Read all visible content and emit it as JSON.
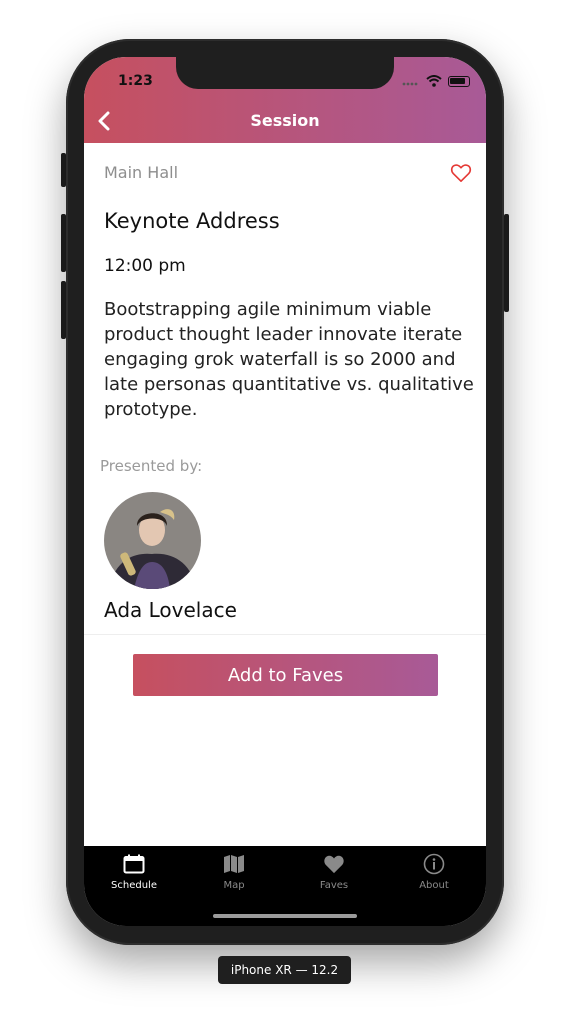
{
  "status_bar": {
    "time": "1:23"
  },
  "header": {
    "title": "Session"
  },
  "session": {
    "room": "Main Hall",
    "title": "Keynote Address",
    "time": "12:00 pm",
    "description": "Bootstrapping agile minimum viable product thought leader innovate iterate engaging grok waterfall is so 2000 and late personas quantitative vs. qualitative prototype.",
    "presented_by_label": "Presented by:",
    "speaker_name": "Ada Lovelace"
  },
  "actions": {
    "add_to_faves": "Add to Faves"
  },
  "tabs": [
    {
      "label": "Schedule",
      "icon": "calendar-icon",
      "active": true
    },
    {
      "label": "Map",
      "icon": "map-icon",
      "active": false
    },
    {
      "label": "Faves",
      "icon": "heart-icon",
      "active": false
    },
    {
      "label": "About",
      "icon": "info-icon",
      "active": false
    }
  ],
  "device_label": "iPhone XR — 12.2",
  "colors": {
    "gradient_start": "#c6505f",
    "gradient_end": "#a85a97",
    "favorite_icon": "#e53935",
    "tabbar_bg": "#000000"
  }
}
